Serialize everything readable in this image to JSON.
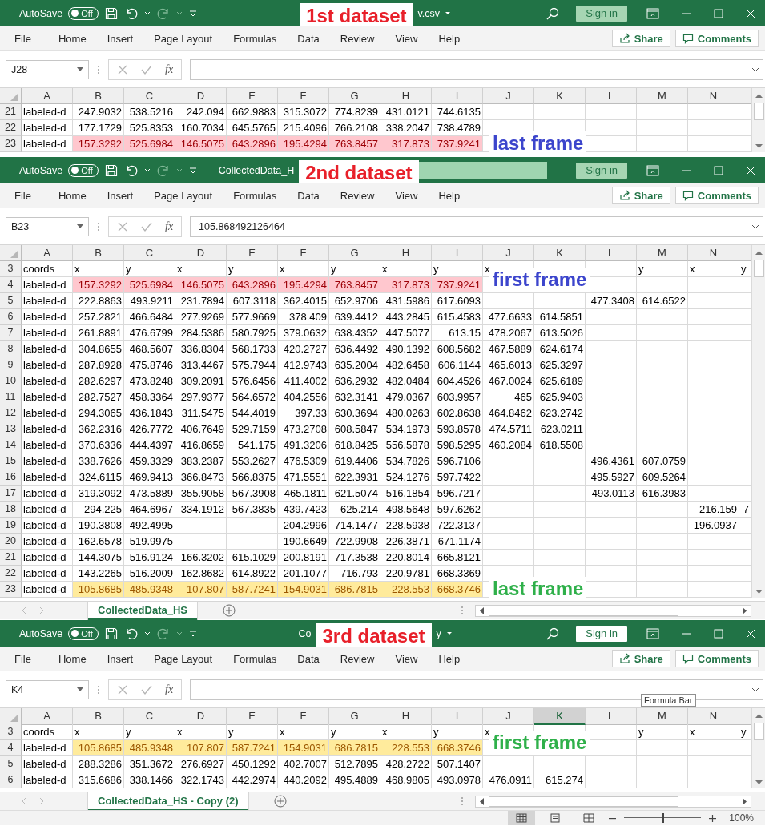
{
  "windows": [
    {
      "active": false,
      "autosave": {
        "label": "AutoSave",
        "on": false,
        "state_label": "Off"
      },
      "title": [
        {
          "kind": "note",
          "text": "1st dataset"
        },
        {
          "kind": "text",
          "text": "v.csv"
        },
        {
          "kind": "caret"
        }
      ],
      "search_icon": true,
      "sign_in": "Sign in",
      "tabs": [
        "File",
        "Home",
        "Insert",
        "Page Layout",
        "Formulas",
        "Data",
        "Review",
        "View",
        "Help"
      ],
      "share": "Share",
      "comments": "Comments",
      "formula_bar": {
        "name_box": "J28",
        "fx": "fx"
      },
      "columns": [
        {
          "label": "A",
          "selected": false
        },
        {
          "label": "B",
          "selected": false
        },
        {
          "label": "C",
          "selected": false
        },
        {
          "label": "D",
          "selected": false
        },
        {
          "label": "E",
          "selected": false
        },
        {
          "label": "F",
          "selected": false
        },
        {
          "label": "G",
          "selected": false
        },
        {
          "label": "H",
          "selected": false
        },
        {
          "label": "I",
          "selected": false
        },
        {
          "label": "J",
          "selected": false
        },
        {
          "label": "K",
          "selected": false
        },
        {
          "label": "L",
          "selected": false
        },
        {
          "label": "M",
          "selected": false
        },
        {
          "label": "N",
          "selected": false
        }
      ],
      "rows": [
        {
          "num": "21",
          "cells": [
            "labeled-d",
            "247.9032",
            "538.5216",
            "242.094",
            "662.9883",
            "315.3072",
            "774.8239",
            "431.0121",
            "744.6135"
          ]
        },
        {
          "num": "22",
          "cells": [
            "labeled-d",
            "177.1729",
            "525.8353",
            "160.7034",
            "645.5765",
            "215.4096",
            "766.2108",
            "338.2047",
            "738.4789"
          ]
        },
        {
          "num": "23",
          "cells": [
            "labeled-d",
            {
              "text": "157.3292",
              "kind": "bad"
            },
            {
              "text": "525.6984",
              "kind": "bad"
            },
            {
              "text": "146.5075",
              "kind": "bad"
            },
            {
              "text": "643.2896",
              "kind": "bad"
            },
            {
              "text": "195.4294",
              "kind": "bad"
            },
            {
              "text": "763.8457",
              "kind": "bad"
            },
            {
              "text": "317.873",
              "kind": "bad"
            },
            {
              "text": "737.9241",
              "kind": "bad"
            }
          ],
          "note": {
            "text": "last frame",
            "color": "#3c45cc"
          }
        }
      ]
    },
    {
      "active": false,
      "autosave": {
        "label": "AutoSave",
        "on": false,
        "state_label": "Off"
      },
      "title": [
        {
          "kind": "text",
          "text": "CollectedData_H"
        },
        {
          "kind": "note",
          "text": "2nd dataset"
        },
        {
          "kind": "search-field"
        }
      ],
      "search_icon": false,
      "sign_in": "Sign in",
      "tabs": [
        "File",
        "Home",
        "Insert",
        "Page Layout",
        "Formulas",
        "Data",
        "Review",
        "View",
        "Help"
      ],
      "share": "Share",
      "comments": "Comments",
      "formula_bar": {
        "name_box": "B23",
        "fx": "fx",
        "value": "105.868492126464"
      },
      "columns": [
        {
          "label": "A",
          "selected": false
        },
        {
          "label": "B",
          "selected": false
        },
        {
          "label": "C",
          "selected": false
        },
        {
          "label": "D",
          "selected": false
        },
        {
          "label": "E",
          "selected": false
        },
        {
          "label": "F",
          "selected": false
        },
        {
          "label": "G",
          "selected": false
        },
        {
          "label": "H",
          "selected": false
        },
        {
          "label": "I",
          "selected": false
        },
        {
          "label": "J",
          "selected": false
        },
        {
          "label": "K",
          "selected": false
        },
        {
          "label": "L",
          "selected": false
        },
        {
          "label": "M",
          "selected": false
        },
        {
          "label": "N",
          "selected": false
        }
      ],
      "rows": [
        {
          "num": "3",
          "cells": [
            "coords",
            "x",
            "y",
            "x",
            "y",
            "x",
            "y",
            "x",
            "y",
            "x",
            null,
            null,
            "y",
            "x",
            "y"
          ]
        },
        {
          "num": "4",
          "cells": [
            "labeled-d",
            {
              "text": "157.3292",
              "kind": "bad"
            },
            {
              "text": "525.6984",
              "kind": "bad"
            },
            {
              "text": "146.5075",
              "kind": "bad"
            },
            {
              "text": "643.2896",
              "kind": "bad"
            },
            {
              "text": "195.4294",
              "kind": "bad"
            },
            {
              "text": "763.8457",
              "kind": "bad"
            },
            {
              "text": "317.873",
              "kind": "bad"
            },
            {
              "text": "737.9241",
              "kind": "bad"
            }
          ],
          "note": {
            "text": "first frame",
            "color": "#3c45cc"
          }
        },
        {
          "num": "5",
          "cells": [
            "labeled-d",
            "222.8863",
            "493.9211",
            "231.7894",
            "607.3118",
            "362.4015",
            "652.9706",
            "431.5986",
            "617.6093",
            null,
            null,
            "477.3408",
            "614.6522"
          ]
        },
        {
          "num": "6",
          "cells": [
            "labeled-d",
            "257.2821",
            "466.6484",
            "277.9269",
            "577.9669",
            "378.409",
            "639.4412",
            "443.2845",
            "615.4583",
            "477.6633",
            "614.5851"
          ]
        },
        {
          "num": "7",
          "cells": [
            "labeled-d",
            "261.8891",
            "476.6799",
            "284.5386",
            "580.7925",
            "379.0632",
            "638.4352",
            "447.5077",
            "613.15",
            "478.2067",
            "613.5026"
          ]
        },
        {
          "num": "8",
          "cells": [
            "labeled-d",
            "304.8655",
            "468.5607",
            "336.8304",
            "568.1733",
            "420.2727",
            "636.4492",
            "490.1392",
            "608.5682",
            "467.5889",
            "624.6174"
          ]
        },
        {
          "num": "9",
          "cells": [
            "labeled-d",
            "287.8928",
            "475.8746",
            "313.4467",
            "575.7944",
            "412.9743",
            "635.2004",
            "482.6458",
            "606.1144",
            "465.6013",
            "625.3297"
          ]
        },
        {
          "num": "10",
          "cells": [
            "labeled-d",
            "282.6297",
            "473.8248",
            "309.2091",
            "576.6456",
            "411.4002",
            "636.2932",
            "482.0484",
            "604.4526",
            "467.0024",
            "625.6189"
          ]
        },
        {
          "num": "11",
          "cells": [
            "labeled-d",
            "282.7527",
            "458.3364",
            "297.9377",
            "564.6572",
            "404.2556",
            "632.3141",
            "479.0367",
            "603.9957",
            "465",
            "625.9403"
          ]
        },
        {
          "num": "12",
          "cells": [
            "labeled-d",
            "294.3065",
            "436.1843",
            "311.5475",
            "544.4019",
            "397.33",
            "630.3694",
            "480.0263",
            "602.8638",
            "464.8462",
            "623.2742"
          ]
        },
        {
          "num": "13",
          "cells": [
            "labeled-d",
            "362.2316",
            "426.7772",
            "406.7649",
            "529.7159",
            "473.2708",
            "608.5847",
            "534.1973",
            "593.8578",
            "474.5711",
            "623.0211"
          ]
        },
        {
          "num": "14",
          "cells": [
            "labeled-d",
            "370.6336",
            "444.4397",
            "416.8659",
            "541.175",
            "491.3206",
            "618.8425",
            "556.5878",
            "598.5295",
            "460.2084",
            "618.5508"
          ]
        },
        {
          "num": "15",
          "cells": [
            "labeled-d",
            "338.7626",
            "459.3329",
            "383.2387",
            "553.2627",
            "476.5309",
            "619.4406",
            "534.7826",
            "596.7106",
            null,
            null,
            "496.4361",
            "607.0759"
          ]
        },
        {
          "num": "16",
          "cells": [
            "labeled-d",
            "324.6115",
            "469.9413",
            "366.8473",
            "566.8375",
            "471.5551",
            "622.3931",
            "524.1276",
            "597.7422",
            null,
            null,
            "495.5927",
            "609.5264"
          ]
        },
        {
          "num": "17",
          "cells": [
            "labeled-d",
            "319.3092",
            "473.5889",
            "355.9058",
            "567.3908",
            "465.1811",
            "621.5074",
            "516.1854",
            "596.7217",
            null,
            null,
            "493.0113",
            "616.3983"
          ]
        },
        {
          "num": "18",
          "cells": [
            "labeled-d",
            "294.225",
            "464.6967",
            "334.1912",
            "567.3835",
            "439.7423",
            "625.214",
            "498.5648",
            "597.6262",
            null,
            null,
            null,
            null,
            "216.159",
            "7"
          ]
        },
        {
          "num": "19",
          "cells": [
            "labeled-d",
            "190.3808",
            "492.4995",
            null,
            null,
            "204.2996",
            "714.1477",
            "228.5938",
            "722.3137",
            null,
            null,
            null,
            null,
            "196.0937"
          ]
        },
        {
          "num": "20",
          "cells": [
            "labeled-d",
            "162.6578",
            "519.9975",
            null,
            null,
            "190.6649",
            "722.9908",
            "226.3871",
            "671.1174"
          ]
        },
        {
          "num": "21",
          "cells": [
            "labeled-d",
            "144.3075",
            "516.9124",
            "166.3202",
            "615.1029",
            "200.8191",
            "717.3538",
            "220.8014",
            "665.8121"
          ]
        },
        {
          "num": "22",
          "cells": [
            "labeled-d",
            "143.2265",
            "516.2009",
            "162.8682",
            "614.8922",
            "201.1077",
            "716.793",
            "220.9781",
            "668.3369"
          ]
        },
        {
          "num": "23",
          "cells": [
            "labeled-d",
            {
              "text": "105.8685",
              "kind": "neutral"
            },
            {
              "text": "485.9348",
              "kind": "neutral"
            },
            {
              "text": "107.807",
              "kind": "neutral"
            },
            {
              "text": "587.7241",
              "kind": "neutral"
            },
            {
              "text": "154.9031",
              "kind": "neutral"
            },
            {
              "text": "686.7815",
              "kind": "neutral"
            },
            {
              "text": "228.553",
              "kind": "neutral"
            },
            {
              "text": "668.3746",
              "kind": "neutral"
            }
          ],
          "note": {
            "text": "last frame",
            "color": "#2fb04a"
          }
        }
      ],
      "sheet_tab": {
        "label": "CollectedData_HS",
        "selected": true
      }
    },
    {
      "active": true,
      "autosave": {
        "label": "AutoSave",
        "on": false,
        "state_label": "Off"
      },
      "title": [
        {
          "kind": "text",
          "text": "Co"
        },
        {
          "kind": "note",
          "text": "3rd dataset"
        },
        {
          "kind": "text",
          "text": "y"
        },
        {
          "kind": "caret"
        }
      ],
      "search_icon": true,
      "sign_in": "Sign in",
      "tabs": [
        "File",
        "Home",
        "Insert",
        "Page Layout",
        "Formulas",
        "Data",
        "Review",
        "View",
        "Help"
      ],
      "share": "Share",
      "comments": "Comments",
      "formula_bar": {
        "name_box": "K4",
        "fx": "fx"
      },
      "tooltip": "Formula Bar",
      "columns": [
        {
          "label": "A",
          "selected": false
        },
        {
          "label": "B",
          "selected": false
        },
        {
          "label": "C",
          "selected": false
        },
        {
          "label": "D",
          "selected": false
        },
        {
          "label": "E",
          "selected": false
        },
        {
          "label": "F",
          "selected": false
        },
        {
          "label": "G",
          "selected": false
        },
        {
          "label": "H",
          "selected": false
        },
        {
          "label": "I",
          "selected": false
        },
        {
          "label": "J",
          "selected": false
        },
        {
          "label": "K",
          "selected": true
        },
        {
          "label": "L",
          "selected": false
        },
        {
          "label": "M",
          "selected": false
        },
        {
          "label": "N",
          "selected": false
        }
      ],
      "rows": [
        {
          "num": "3",
          "cells": [
            "coords",
            "x",
            "y",
            "x",
            "y",
            "x",
            "y",
            "x",
            "y",
            "x",
            null,
            null,
            "y",
            "x",
            "y"
          ]
        },
        {
          "num": "4",
          "cells": [
            "labeled-d",
            {
              "text": "105.8685",
              "kind": "neutral"
            },
            {
              "text": "485.9348",
              "kind": "neutral"
            },
            {
              "text": "107.807",
              "kind": "neutral"
            },
            {
              "text": "587.7241",
              "kind": "neutral"
            },
            {
              "text": "154.9031",
              "kind": "neutral"
            },
            {
              "text": "686.7815",
              "kind": "neutral"
            },
            {
              "text": "228.553",
              "kind": "neutral"
            },
            {
              "text": "668.3746",
              "kind": "neutral"
            }
          ],
          "note": {
            "text": "first frame",
            "color": "#2fb04a"
          }
        },
        {
          "num": "5",
          "cells": [
            "labeled-d",
            "288.3286",
            "351.3672",
            "276.6927",
            "450.1292",
            "402.7007",
            "512.7895",
            "428.2722",
            "507.1407"
          ]
        },
        {
          "num": "6",
          "cells": [
            "labeled-d",
            "315.6686",
            "338.1466",
            "322.1743",
            "442.2974",
            "440.2092",
            "495.4889",
            "468.9805",
            "493.0978",
            "476.0911",
            "615.274"
          ]
        }
      ],
      "sheet_tab": {
        "label": "CollectedData_HS - Copy (2)",
        "selected": true
      },
      "status_bar": {
        "views": [
          {
            "kind": "normal",
            "selected": true
          },
          {
            "kind": "page-layout",
            "selected": false
          },
          {
            "kind": "page-break",
            "selected": false
          }
        ],
        "zoom": {
          "level": 0.5,
          "reading": "100%"
        }
      }
    }
  ]
}
